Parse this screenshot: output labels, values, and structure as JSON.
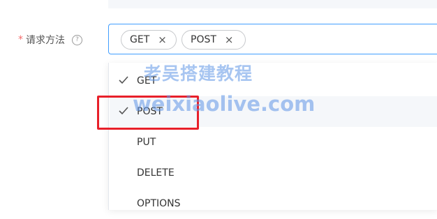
{
  "form": {
    "required_mark": "*",
    "label": "请求方法",
    "help_icon": "?"
  },
  "select": {
    "tags": [
      {
        "label": "GET",
        "close": "×"
      },
      {
        "label": "POST",
        "close": "×"
      }
    ]
  },
  "dropdown": {
    "options": [
      {
        "label": "GET",
        "selected": true
      },
      {
        "label": "POST",
        "selected": true
      },
      {
        "label": "PUT",
        "selected": false
      },
      {
        "label": "DELETE",
        "selected": false
      },
      {
        "label": "OPTIONS",
        "selected": false
      }
    ]
  },
  "watermark": {
    "line1": "老吴搭建教程",
    "line2": "weixiaolive.com"
  },
  "colors": {
    "focus_border": "#409eff",
    "required": "#f56c6c",
    "highlight": "#e8202a",
    "watermark": "#5f96e6"
  }
}
